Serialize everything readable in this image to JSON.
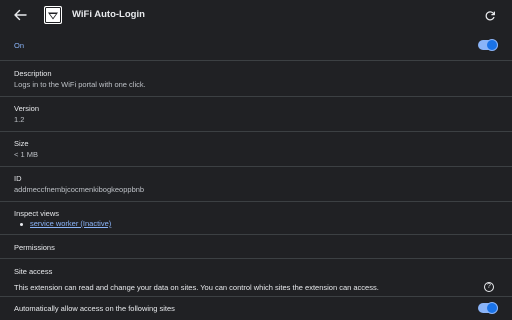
{
  "header": {
    "back_icon": "arrow-left-icon",
    "extension_name": "WiFi Auto-Login",
    "reload_icon": "reload-icon"
  },
  "on_toggle": {
    "label": "On",
    "enabled": true
  },
  "description": {
    "label": "Description",
    "value": "Logs in to the WiFi portal with one click."
  },
  "version": {
    "label": "Version",
    "value": "1.2"
  },
  "size": {
    "label": "Size",
    "value": "< 1 MB"
  },
  "id": {
    "label": "ID",
    "value": "addmeccfnembjcocmenkibogkeoppbnb"
  },
  "inspect_views": {
    "label": "Inspect views",
    "items": [
      "service worker (Inactive)"
    ]
  },
  "permissions": {
    "label": "Permissions"
  },
  "site_access": {
    "label": "Site access",
    "description": "This extension can read and change your data on sites. You can control which sites the extension can access.",
    "help_icon": "help-icon"
  },
  "auto_allow": {
    "label": "Automatically allow access on the following sites",
    "enabled": true
  },
  "colors": {
    "background": "#202124",
    "accent": "#8ab4f8",
    "toggle_knob": "#1a73e8",
    "divider": "#3c4043"
  }
}
